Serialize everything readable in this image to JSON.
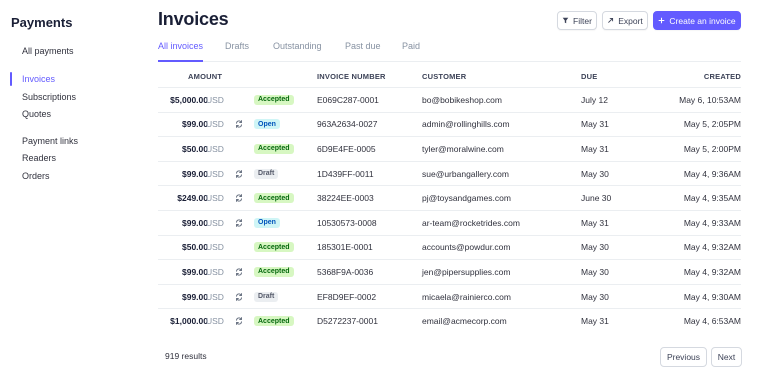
{
  "sidebar": {
    "title": "Payments",
    "items": [
      {
        "label": "All payments",
        "name": "sidebar-item-all-payments",
        "active": false
      },
      {
        "label": "Invoices",
        "name": "sidebar-item-invoices",
        "active": true
      },
      {
        "label": "Subscriptions",
        "name": "sidebar-item-subscriptions",
        "active": false
      },
      {
        "label": "Quotes",
        "name": "sidebar-item-quotes",
        "active": false
      },
      {
        "label": "Payment links",
        "name": "sidebar-item-payment-links",
        "active": false
      },
      {
        "label": "Readers",
        "name": "sidebar-item-readers",
        "active": false
      },
      {
        "label": "Orders",
        "name": "sidebar-item-orders",
        "active": false
      }
    ]
  },
  "header": {
    "title": "Invoices",
    "filter_label": "Filter",
    "export_label": "Export",
    "create_label": "Create an invoice"
  },
  "tabs": [
    {
      "label": "All invoices",
      "active": true
    },
    {
      "label": "Drafts",
      "active": false
    },
    {
      "label": "Outstanding",
      "active": false
    },
    {
      "label": "Past due",
      "active": false
    },
    {
      "label": "Paid",
      "active": false
    }
  ],
  "table": {
    "columns": {
      "amount": "AMOUNT",
      "invoice_number": "INVOICE NUMBER",
      "customer": "CUSTOMER",
      "due": "DUE",
      "created": "CREATED"
    },
    "rows": [
      {
        "amount": "$5,000.00",
        "currency": "USD",
        "recurring": false,
        "status": "Accepted",
        "status_type": "accepted",
        "invoice_number": "E069C287-0001",
        "customer": "bo@bobikeshop.com",
        "due": "July 12",
        "created": "May 6, 10:53AM"
      },
      {
        "amount": "$99.00",
        "currency": "USD",
        "recurring": true,
        "status": "Open",
        "status_type": "open",
        "invoice_number": "963A2634-0027",
        "customer": "admin@rollinghills.com",
        "due": "May 31",
        "created": "May 5, 2:05PM"
      },
      {
        "amount": "$50.00",
        "currency": "USD",
        "recurring": false,
        "status": "Accepted",
        "status_type": "accepted",
        "invoice_number": "6D9E4FE-0005",
        "customer": "tyler@moralwine.com",
        "due": "May 31",
        "created": "May 5, 2:00PM"
      },
      {
        "amount": "$99.00",
        "currency": "USD",
        "recurring": true,
        "status": "Draft",
        "status_type": "draft",
        "invoice_number": "1D439FF-0011",
        "customer": "sue@urbangallery.com",
        "due": "May 30",
        "created": "May 4, 9:36AM"
      },
      {
        "amount": "$249.00",
        "currency": "USD",
        "recurring": true,
        "status": "Accepted",
        "status_type": "accepted",
        "invoice_number": "38224EE-0003",
        "customer": "pj@toysandgames.com",
        "due": "June 30",
        "created": "May 4, 9:35AM"
      },
      {
        "amount": "$99.00",
        "currency": "USD",
        "recurring": true,
        "status": "Open",
        "status_type": "open",
        "invoice_number": "10530573-0008",
        "customer": "ar-team@rocketrides.com",
        "due": "May 31",
        "created": "May 4, 9:33AM"
      },
      {
        "amount": "$50.00",
        "currency": "USD",
        "recurring": false,
        "status": "Accepted",
        "status_type": "accepted",
        "invoice_number": "185301E-0001",
        "customer": "accounts@powdur.com",
        "due": "May 30",
        "created": "May 4, 9:32AM"
      },
      {
        "amount": "$99.00",
        "currency": "USD",
        "recurring": true,
        "status": "Accepted",
        "status_type": "accepted",
        "invoice_number": "5368F9A-0036",
        "customer": "jen@pipersupplies.com",
        "due": "May 30",
        "created": "May 4, 9:32AM"
      },
      {
        "amount": "$99.00",
        "currency": "USD",
        "recurring": true,
        "status": "Draft",
        "status_type": "draft",
        "invoice_number": "EF8D9EF-0002",
        "customer": "micaela@rainierco.com",
        "due": "May 30",
        "created": "May 4, 9:30AM"
      },
      {
        "amount": "$1,000.00",
        "currency": "USD",
        "recurring": true,
        "status": "Accepted",
        "status_type": "accepted",
        "invoice_number": "D5272237-0001",
        "customer": "email@acmecorp.com",
        "due": "May 31",
        "created": "May 4, 6:53AM"
      }
    ]
  },
  "footer": {
    "results": "919 results",
    "previous_label": "Previous",
    "next_label": "Next"
  },
  "colors": {
    "accent": "#635bff",
    "accepted_bg": "#d7f7c2",
    "open_bg": "#cff5f6",
    "draft_bg": "#ebeef1"
  },
  "icons": {
    "recurring": "recurring-icon",
    "filter": "filter-icon",
    "export": "export-icon",
    "add": "plus-icon"
  }
}
